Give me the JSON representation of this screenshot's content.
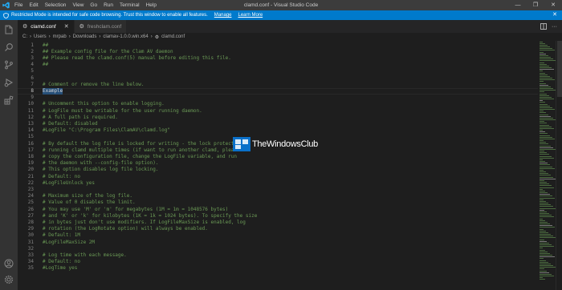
{
  "window": {
    "title": "clamd.conf - Visual Studio Code",
    "menu": [
      "File",
      "Edit",
      "Selection",
      "View",
      "Go",
      "Run",
      "Terminal",
      "Help"
    ],
    "controls": {
      "minimize": "—",
      "maximize": "❐",
      "close": "✕"
    }
  },
  "banner": {
    "message": "Restricted Mode is intended for safe code browsing. Trust this window to enable all features.",
    "manage": "Manage",
    "learn_more": "Learn More",
    "close": "✕"
  },
  "tabs": [
    {
      "label": "clamd.conf",
      "active": true,
      "close": "✕"
    },
    {
      "label": "freshclam.conf",
      "active": false
    }
  ],
  "breadcrumb": [
    "C:",
    "Users",
    "mrpab",
    "Downloads",
    "clamav-1.0.0.win.x64",
    "clamd.conf"
  ],
  "editor": {
    "current_line": 8,
    "lines": [
      {
        "n": "1",
        "t": "##"
      },
      {
        "n": "2",
        "t": "## Example config file for the Clam AV daemon"
      },
      {
        "n": "3",
        "t": "## Please read the clamd.conf(5) manual before editing this file."
      },
      {
        "n": "4",
        "t": "##"
      },
      {
        "n": "5",
        "t": ""
      },
      {
        "n": "6",
        "t": ""
      },
      {
        "n": "7",
        "t": "# Comment or remove the line below."
      },
      {
        "n": "8",
        "t": "Example"
      },
      {
        "n": "9",
        "t": ""
      },
      {
        "n": "10",
        "t": "# Uncomment this option to enable logging."
      },
      {
        "n": "11",
        "t": "# LogFile must be writable for the user running daemon."
      },
      {
        "n": "12",
        "t": "# A full path is required."
      },
      {
        "n": "13",
        "t": "# Default: disabled"
      },
      {
        "n": "14",
        "t": "#LogFile \"C:\\Program Files\\ClamAV\\clamd.log\""
      },
      {
        "n": "15",
        "t": ""
      },
      {
        "n": "16",
        "t": "# By default the log file is locked for writing - the lock protects"
      },
      {
        "n": "17",
        "t": "# running clamd multiple times (if want to run another clamd, please"
      },
      {
        "n": "18",
        "t": "# copy the configuration file, change the LogFile variable, and run"
      },
      {
        "n": "19",
        "t": "# the daemon with --config-file option)."
      },
      {
        "n": "20",
        "t": "# This option disables log file locking."
      },
      {
        "n": "21",
        "t": "# Default: no"
      },
      {
        "n": "22",
        "t": "#LogFileUnlock yes"
      },
      {
        "n": "23",
        "t": ""
      },
      {
        "n": "24",
        "t": "# Maximum size of the log file."
      },
      {
        "n": "25",
        "t": "# Value of 0 disables the limit."
      },
      {
        "n": "26",
        "t": "# You may use 'M' or 'm' for megabytes (1M = 1m = 1048576 bytes)"
      },
      {
        "n": "27",
        "t": "# and 'K' or 'k' for kilobytes (1K = 1k = 1024 bytes). To specify the size"
      },
      {
        "n": "28",
        "t": "# in bytes just don't use modifiers. If LogFileMaxSize is enabled, log"
      },
      {
        "n": "29",
        "t": "# rotation (the LogRotate option) will always be enabled."
      },
      {
        "n": "30",
        "t": "# Default: 1M"
      },
      {
        "n": "31",
        "t": "#LogFileMaxSize 2M"
      },
      {
        "n": "32",
        "t": ""
      },
      {
        "n": "33",
        "t": "# Log time with each message."
      },
      {
        "n": "34",
        "t": "# Default: no"
      },
      {
        "n": "35",
        "t": "#LogTime yes"
      }
    ]
  },
  "watermark": {
    "text": "TheWindowsClub"
  },
  "colors": {
    "titlebar": "#3c3c3c",
    "banner": "#007acc",
    "activity_bar": "#333333",
    "editor_bg": "#1e1e1e",
    "comment": "#6a9955",
    "selection": "#264f78"
  },
  "icons": {
    "activity": [
      "explorer-icon",
      "search-icon",
      "source-control-icon",
      "run-debug-icon",
      "extensions-icon",
      "account-icon",
      "settings-gear-icon"
    ],
    "tab_actions": [
      "split-editor-icon",
      "more-actions-icon"
    ]
  }
}
